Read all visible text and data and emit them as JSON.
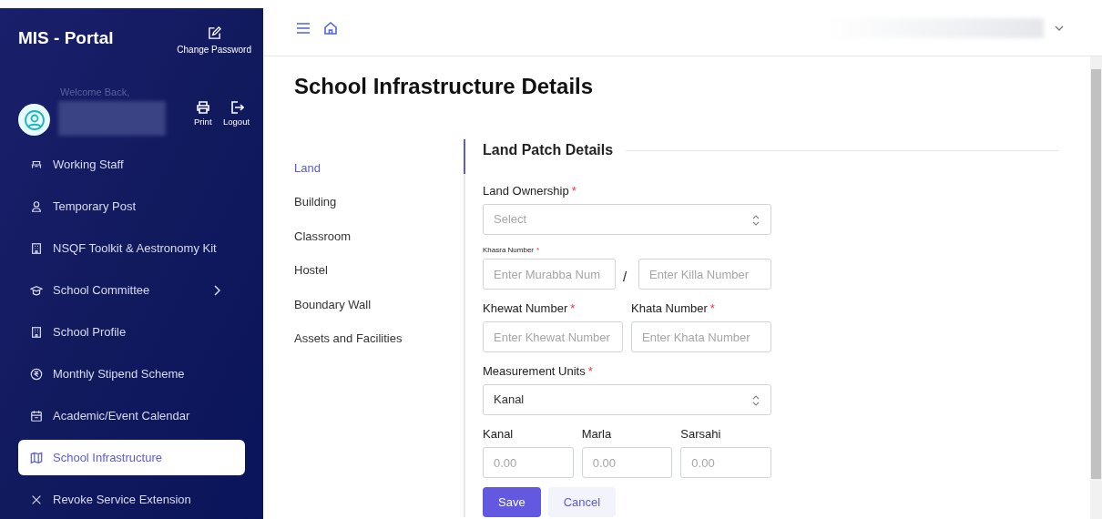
{
  "sidebar": {
    "title": "MIS - Portal",
    "change_password": "Change Password",
    "welcome": "Welcome Back,",
    "print": "Print",
    "logout": "Logout",
    "items": [
      {
        "label": "Working Staff",
        "selected": false,
        "has_submenu": false
      },
      {
        "label": "Temporary Post",
        "selected": false,
        "has_submenu": false
      },
      {
        "label": "NSQF Toolkit & Aestronomy Kit",
        "selected": false,
        "has_submenu": false
      },
      {
        "label": "School Committee",
        "selected": false,
        "has_submenu": true
      },
      {
        "label": "School Profile",
        "selected": false,
        "has_submenu": false
      },
      {
        "label": "Monthly Stipend Scheme",
        "selected": false,
        "has_submenu": false
      },
      {
        "label": "Academic/Event Calendar",
        "selected": false,
        "has_submenu": false
      },
      {
        "label": "School Infrastructure",
        "selected": true,
        "has_submenu": false
      },
      {
        "label": "Revoke Service Extension",
        "selected": false,
        "has_submenu": false
      }
    ]
  },
  "page": {
    "title": "School Infrastructure Details"
  },
  "sections": [
    {
      "label": "Land",
      "selected": true
    },
    {
      "label": "Building",
      "selected": false
    },
    {
      "label": "Classroom",
      "selected": false
    },
    {
      "label": "Hostel",
      "selected": false
    },
    {
      "label": "Boundary Wall",
      "selected": false
    },
    {
      "label": "Assets and Facilities",
      "selected": false
    }
  ],
  "form": {
    "heading": "Land Patch Details",
    "land_ownership": {
      "label": "Land Ownership",
      "required_mark": "*",
      "placeholder": "Select"
    },
    "khasra": {
      "label": "Khasra Number",
      "required_mark": "*",
      "murabba_placeholder": "Enter Murabba Num",
      "separator": "/",
      "killa_placeholder": "Enter Killa Number"
    },
    "khewat": {
      "label": "Khewat Number",
      "required_mark": "*",
      "placeholder": "Enter Khewat Number"
    },
    "khata": {
      "label": "Khata Number",
      "required_mark": "*",
      "placeholder": "Enter Khata Number"
    },
    "units": {
      "label": "Measurement Units",
      "required_mark": "*",
      "value": "Kanal"
    },
    "areas": [
      {
        "label": "Kanal",
        "placeholder": "0.00"
      },
      {
        "label": "Marla",
        "placeholder": "0.00"
      },
      {
        "label": "Sarsahi",
        "placeholder": "0.00"
      }
    ],
    "save": "Save",
    "cancel": "Cancel"
  }
}
